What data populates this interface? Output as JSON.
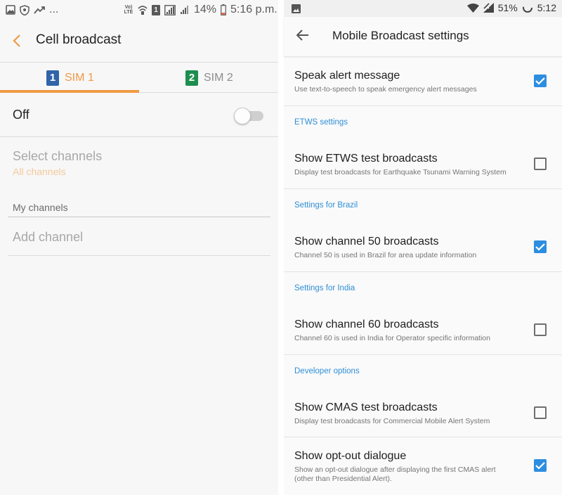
{
  "left_screen": {
    "status_bar": {
      "ellipsis": "...",
      "network_label_top": "Vo)",
      "network_label_bottom": "LTE",
      "sim_number": "1",
      "battery_percent": "14%",
      "time": "5:16 p.m."
    },
    "app_bar": {
      "title": "Cell broadcast"
    },
    "tabs": [
      {
        "number": "1",
        "label": "SIM 1",
        "selected": true
      },
      {
        "number": "2",
        "label": "SIM 2",
        "selected": false
      }
    ],
    "off_row": {
      "label": "Off",
      "toggle_on": false
    },
    "select_channels": {
      "title": "Select channels",
      "subtitle": "All channels"
    },
    "my_channels_header": "My channels",
    "add_channel": "Add channel"
  },
  "right_screen": {
    "status_bar": {
      "battery_percent": "51%",
      "time": "5:12"
    },
    "app_bar": {
      "title": "Mobile Broadcast settings"
    },
    "sections": {
      "etws": "ETWS settings",
      "brazil": "Settings for Brazil",
      "india": "Settings for India",
      "developer": "Developer options"
    },
    "items": [
      {
        "title": "Speak alert message",
        "desc": "Use text-to-speech to speak emergency alert messages",
        "checked": true
      },
      {
        "title": "Show ETWS test broadcasts",
        "desc": "Display test broadcasts for Earthquake Tsunami Warning System",
        "checked": false
      },
      {
        "title": "Show channel 50 broadcasts",
        "desc": "Channel 50 is used in Brazil for area update information",
        "checked": true
      },
      {
        "title": "Show channel 60 broadcasts",
        "desc": "Channel 60 is used in India for Operator specific information",
        "checked": false
      },
      {
        "title": "Show CMAS test broadcasts",
        "desc": "Display test broadcasts for Commercial Mobile Alert System",
        "checked": false
      },
      {
        "title": "Show opt-out dialogue",
        "desc_line1": "Show an opt-out dialogue after displaying the first CMAS alert",
        "desc_line2": "(other than Presidential Alert).",
        "checked": true
      }
    ]
  },
  "colors": {
    "left_accent": "#f09a44",
    "sim1_badge": "#2f64a8",
    "sim2_badge": "#1e8e4f",
    "right_accent": "#2d8ee0",
    "section_header": "#2e8fd6"
  },
  "icons": {
    "left_status": [
      "image-icon",
      "shield-icon",
      "trending-icon",
      "wifi-icon",
      "sim-icon",
      "signal-icon",
      "signal-icon",
      "battery-icon"
    ],
    "left_app_bar": "back-chevron-icon",
    "right_status": [
      "image-icon",
      "wifi-icon",
      "signal-icon",
      "battery-icon"
    ],
    "right_app_bar": "back-arrow-icon",
    "checkbox": "checkmark-icon"
  }
}
